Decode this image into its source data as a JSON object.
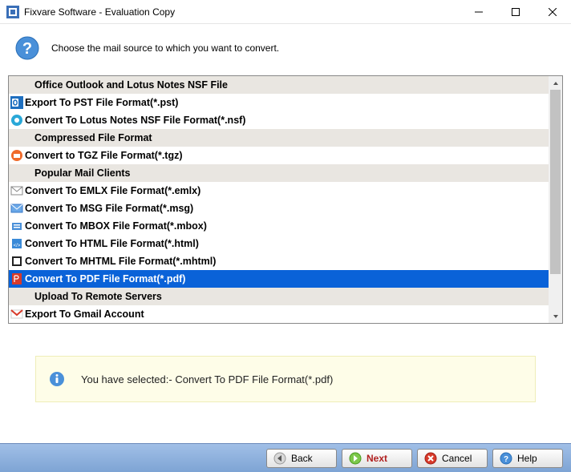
{
  "window": {
    "title": "Fixvare Software - Evaluation Copy"
  },
  "header": {
    "instruction": "Choose the mail source to which you want to convert."
  },
  "list": {
    "rows": [
      {
        "type": "header",
        "label": "Office Outlook and Lotus Notes NSF File",
        "icon": ""
      },
      {
        "type": "item",
        "label": "Export To PST File Format(*.pst)",
        "icon": "outlook",
        "selected": false
      },
      {
        "type": "item",
        "label": "Convert To Lotus Notes NSF File Format(*.nsf)",
        "icon": "nsf",
        "selected": false
      },
      {
        "type": "header",
        "label": "Compressed File Format",
        "icon": ""
      },
      {
        "type": "item",
        "label": "Convert to TGZ File Format(*.tgz)",
        "icon": "tgz",
        "selected": false
      },
      {
        "type": "header",
        "label": "Popular Mail Clients",
        "icon": ""
      },
      {
        "type": "item",
        "label": "Convert To EMLX File Format(*.emlx)",
        "icon": "emlx",
        "selected": false
      },
      {
        "type": "item",
        "label": "Convert To MSG File Format(*.msg)",
        "icon": "msg",
        "selected": false
      },
      {
        "type": "item",
        "label": "Convert To MBOX File Format(*.mbox)",
        "icon": "mbox",
        "selected": false
      },
      {
        "type": "item",
        "label": "Convert To HTML File Format(*.html)",
        "icon": "html",
        "selected": false
      },
      {
        "type": "item",
        "label": "Convert To MHTML File Format(*.mhtml)",
        "icon": "mhtml",
        "selected": false
      },
      {
        "type": "item",
        "label": "Convert To PDF File Format(*.pdf)",
        "icon": "pdf",
        "selected": true
      },
      {
        "type": "header",
        "label": "Upload To Remote Servers",
        "icon": ""
      },
      {
        "type": "item",
        "label": "Export To Gmail Account",
        "icon": "gmail",
        "selected": false
      }
    ]
  },
  "info": {
    "prefix": "You have selected:- ",
    "value": "Convert To PDF File Format(*.pdf)"
  },
  "footer": {
    "back": "Back",
    "next": "Next",
    "cancel": "Cancel",
    "help": "Help"
  }
}
